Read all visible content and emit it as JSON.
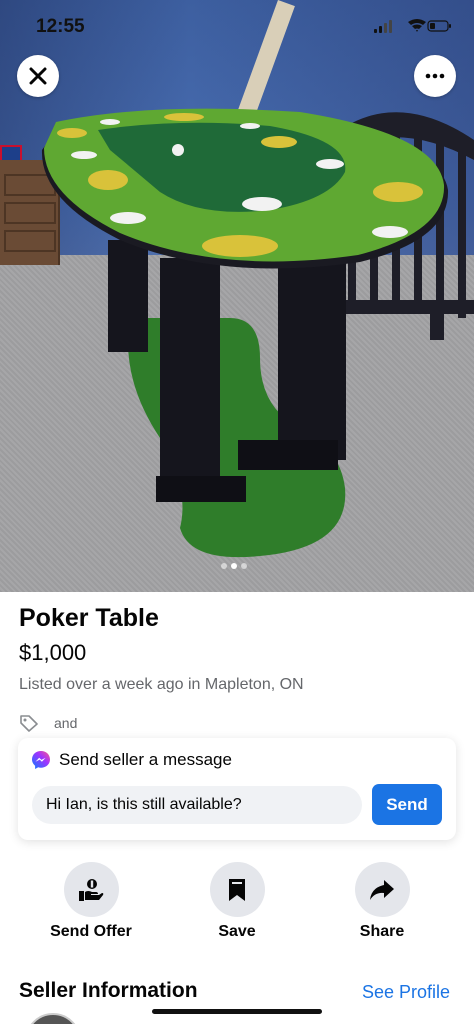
{
  "status_bar": {
    "time": "12:55"
  },
  "photo": {
    "image_description": "poker-table-photo",
    "current_index": 2,
    "total": 3
  },
  "listing": {
    "title": "Poker Table",
    "price": "$1,000",
    "listed": "Listed over a week ago in Mapleton, ON",
    "tags_text": "and"
  },
  "message": {
    "heading": "Send seller a message",
    "input_value": "Hi Ian, is this still available?",
    "send_label": "Send"
  },
  "actions": [
    {
      "label": "Send Offer",
      "icon": "offer-icon"
    },
    {
      "label": "Save",
      "icon": "bookmark-icon"
    },
    {
      "label": "Share",
      "icon": "share-arrow-icon"
    }
  ],
  "seller": {
    "heading": "Seller Information",
    "see_profile": "See Profile"
  },
  "colors": {
    "accent": "#1b74e4",
    "action_bg": "#e4e6eb"
  }
}
